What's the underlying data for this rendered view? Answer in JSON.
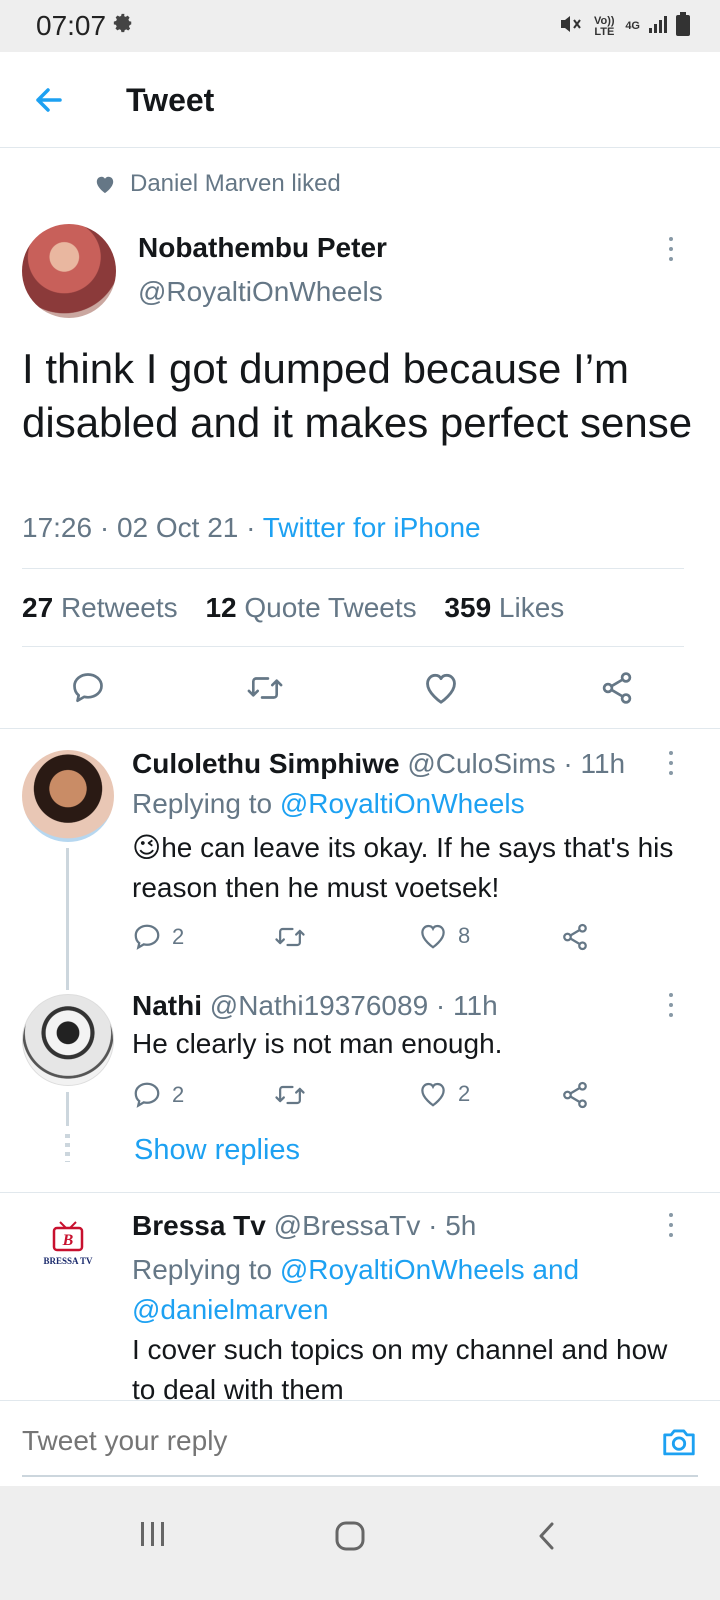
{
  "status_bar": {
    "time": "07:07",
    "network_volte": "Vo)) LTE",
    "network_4g": "4G"
  },
  "header": {
    "title": "Tweet"
  },
  "social_context": {
    "text": "Daniel Marven liked"
  },
  "tweet": {
    "author_name": "Nobathembu Peter",
    "author_handle": "@RoyaltiOnWheels",
    "text": "I think I got dumped because I’m disabled and it makes perfect sense",
    "time_date": "17:26 · 02 Oct 21 · ",
    "source": "Twitter for iPhone",
    "stats": {
      "retweets_count": "27",
      "retweets_label": "Retweets",
      "quotes_count": "12",
      "quotes_label": "Quote Tweets",
      "likes_count": "359",
      "likes_label": "Likes"
    }
  },
  "replies": [
    {
      "name": "Culolethu Simphiwe",
      "handle_time": "@CuloSims · 11h",
      "replying_prefix": "Replying to ",
      "replying_to": "@RoyaltiOnWheels",
      "emoji": "😉",
      "text": "he can leave its okay. If he says that's his reason then he must voetsek!",
      "reply_count": "2",
      "like_count": "8"
    },
    {
      "name": "Nathi",
      "handle_time": "@Nathi19376089 · 11h",
      "text": "He clearly is not man enough.",
      "reply_count": "2",
      "like_count": "2"
    },
    {
      "name": "Bressa Tv",
      "handle_time": "@BressaTv · 5h",
      "replying_prefix": "Replying to ",
      "replying_to": "@RoyaltiOnWheels and @danielmarven",
      "text": "I cover such topics on my channel and how to deal with them",
      "logo_text": "BRESSA TV"
    }
  ],
  "show_replies_label": "Show replies",
  "reply_box": {
    "placeholder": "Tweet your reply"
  },
  "colors": {
    "accent": "#1da1f2",
    "secondary_text": "#657786",
    "primary_text": "#14171a",
    "divider": "#e1e8ed"
  }
}
